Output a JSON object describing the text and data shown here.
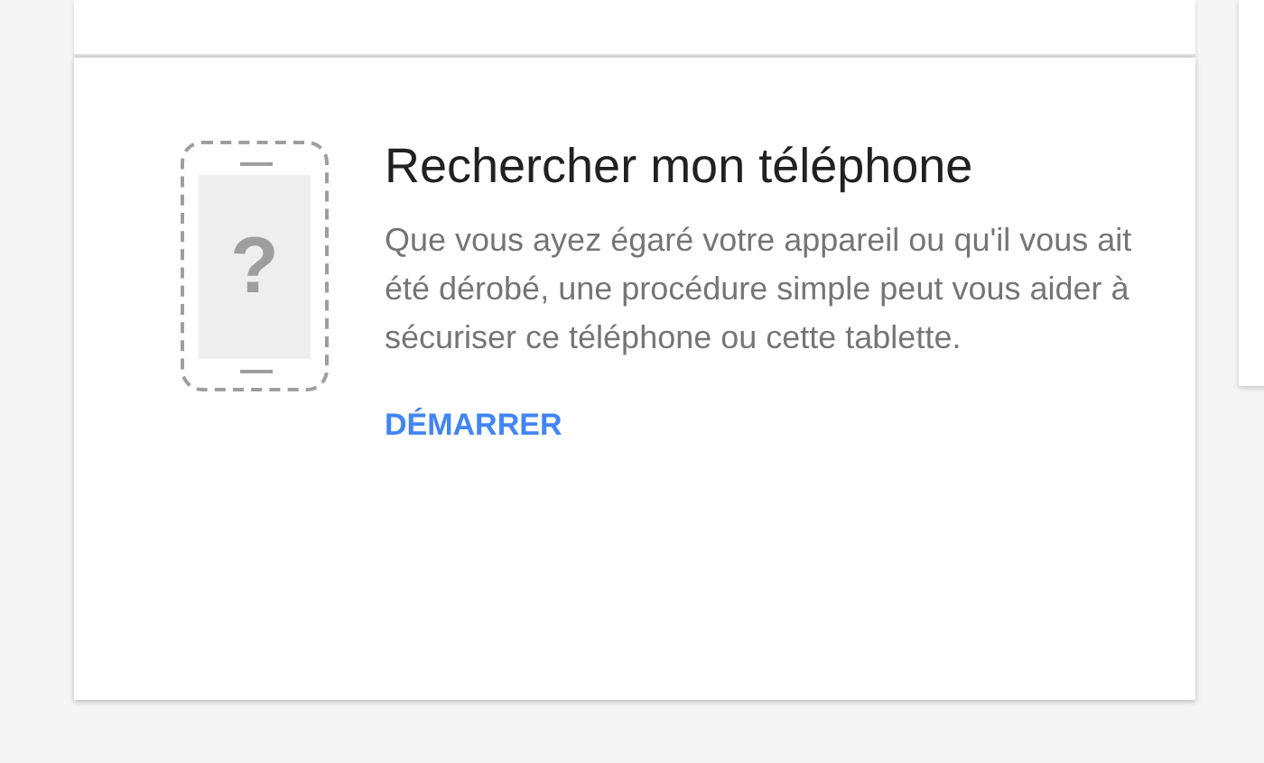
{
  "card": {
    "icon_glyph": "?",
    "title": "Rechercher mon téléphone",
    "description": "Que vous ayez égaré votre appareil ou qu'il vous ait été dérobé, une procédure simple peut vous aider à sécuriser ce téléphone ou cette tablette.",
    "action": "DÉMARRER"
  }
}
